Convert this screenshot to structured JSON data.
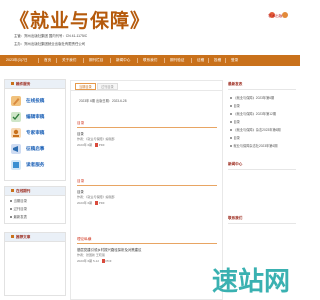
{
  "header": {
    "title": "《就业与保障》",
    "meta_line1": "主管：郑州出版社集团    国内刊号：CN 41-1175/C",
    "meta_line2": "主办：郑州出版社集团就业出版社有限责任公司",
    "logo_text": "学术出版"
  },
  "nav": {
    "items": [
      "2023年(3)7日",
      "首页",
      "关于我们",
      "期刊栏目",
      "新闻中心",
      "联系我们",
      "期刊验证",
      "征稿",
      "投稿",
      "登录"
    ]
  },
  "sidebar": {
    "services_title": "稿件服务",
    "services": [
      {
        "label": "在线投稿",
        "icon": "edit-icon",
        "color": "#d9893d"
      },
      {
        "label": "编辑审稿",
        "icon": "review-icon",
        "color": "#2f7d3c"
      },
      {
        "label": "专家审稿",
        "icon": "expert-icon",
        "color": "#c9711b"
      },
      {
        "label": "征稿启事",
        "icon": "megaphone-icon",
        "color": "#2b6cb0"
      },
      {
        "label": "读者服务",
        "icon": "reader-icon",
        "color": "#3a8fd1"
      }
    ],
    "browse_title": "在线期刊",
    "browse_links": [
      "当期目录",
      "过刊目录",
      "最新发表"
    ],
    "recommend_title": "推荐文章"
  },
  "main": {
    "tab_current": "当期目录",
    "tab_past": "过刊目录",
    "issue_info": "2023年 6期    出版日期：2023-6-28",
    "sections": [
      {
        "heading": "目录",
        "title": "目录",
        "authors": "作者：《就业与保障》编辑部",
        "pages": "2023年 6期",
        "pdf": "PDF"
      },
      {
        "heading": "目录",
        "title": "目录",
        "authors": "作者：《就业与保障》编辑部",
        "pages": "2023年 6期",
        "pdf": "PDF"
      },
      {
        "heading": "理论纵横",
        "title": "基层党建引领乡村振兴路径探析及对策建议",
        "authors": "作者：张国新 王晓丽",
        "pages": "2023年 6期    5-12",
        "pdf": "PDF"
      }
    ]
  },
  "right": {
    "recent_title": "最新发表",
    "recent": [
      "《就业与保障》2023年第6期",
      "目录",
      "《就业与保障》2023年第12期",
      "目录",
      "《就业与保障》杂志2023年第6期",
      "目录",
      "就业与保障杂志社2023年第6期"
    ],
    "news_title": "新闻中心",
    "contact_title": "联系我们"
  },
  "watermark": {
    "text": "速站网"
  },
  "colors": {
    "nav": "#c9711b",
    "title": "#b55a0c",
    "heading": "#9c2a1d",
    "accent_red": "#d0321b",
    "link_blue": "#1f63b8"
  }
}
